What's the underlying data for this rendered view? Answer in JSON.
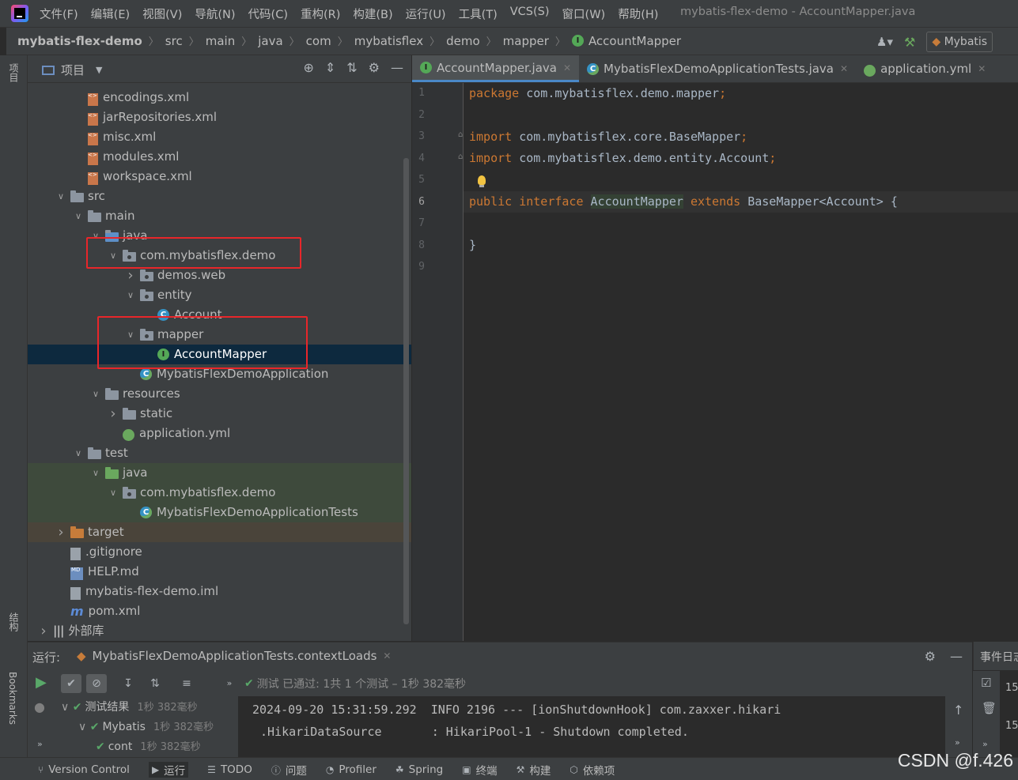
{
  "menubar": {
    "items": [
      "文件(F)",
      "编辑(E)",
      "视图(V)",
      "导航(N)",
      "代码(C)",
      "重构(R)",
      "构建(B)",
      "运行(U)",
      "工具(T)",
      "VCS(S)",
      "窗口(W)",
      "帮助(H)"
    ],
    "window_title": "mybatis-flex-demo - AccountMapper.java"
  },
  "navbar": {
    "breadcrumbs": [
      "mybatis-flex-demo",
      "src",
      "main",
      "java",
      "com",
      "mybatisflex",
      "demo",
      "mapper",
      "AccountMapper"
    ],
    "run_config": "Mybatis"
  },
  "left_strip": {
    "project_label": "项目",
    "structure_label": "结构",
    "bookmarks_label": "Bookmarks"
  },
  "project_panel": {
    "title": "项目",
    "tree": [
      {
        "label": "encodings.xml",
        "icon": "xml-file-icon",
        "depth": 3
      },
      {
        "label": "jarRepositories.xml",
        "icon": "xml-file-icon",
        "depth": 3
      },
      {
        "label": "misc.xml",
        "icon": "xml-file-icon",
        "depth": 3
      },
      {
        "label": "modules.xml",
        "icon": "xml-file-icon",
        "depth": 3
      },
      {
        "label": "workspace.xml",
        "icon": "xml-file-icon",
        "depth": 3
      },
      {
        "label": "src",
        "icon": "folder-icon",
        "depth": 2,
        "arrow": "open"
      },
      {
        "label": "main",
        "icon": "folder-icon",
        "depth": 3,
        "arrow": "open"
      },
      {
        "label": "java",
        "icon": "source-folder-icon",
        "depth": 4,
        "arrow": "open"
      },
      {
        "label": "com.mybatisflex.demo",
        "icon": "package-icon",
        "depth": 5,
        "arrow": "open"
      },
      {
        "label": "demos.web",
        "icon": "package-icon",
        "depth": 6,
        "arrow": "closed"
      },
      {
        "label": "entity",
        "icon": "package-icon",
        "depth": 6,
        "arrow": "open"
      },
      {
        "label": "Account",
        "icon": "class-icon",
        "depth": 7
      },
      {
        "label": "mapper",
        "icon": "package-icon",
        "depth": 6,
        "arrow": "open"
      },
      {
        "label": "AccountMapper",
        "icon": "interface-icon",
        "depth": 7,
        "selected": true
      },
      {
        "label": "MybatisFlexDemoApplication",
        "icon": "spring-class-icon",
        "depth": 6
      },
      {
        "label": "resources",
        "icon": "resources-folder-icon",
        "depth": 4,
        "arrow": "open"
      },
      {
        "label": "static",
        "icon": "folder-icon",
        "depth": 5,
        "arrow": "closed"
      },
      {
        "label": "application.yml",
        "icon": "yml-file-icon",
        "depth": 5
      },
      {
        "label": "test",
        "icon": "folder-icon",
        "depth": 3,
        "arrow": "open"
      },
      {
        "label": "java",
        "icon": "test-folder-icon",
        "depth": 4,
        "arrow": "open",
        "test": true
      },
      {
        "label": "com.mybatisflex.demo",
        "icon": "package-icon",
        "depth": 5,
        "arrow": "open",
        "test": true
      },
      {
        "label": "MybatisFlexDemoApplicationTests",
        "icon": "spring-class-icon",
        "depth": 6,
        "test": true
      },
      {
        "label": "target",
        "icon": "excluded-folder-icon",
        "depth": 2,
        "arrow": "closed",
        "target": true
      },
      {
        "label": ".gitignore",
        "icon": "file-icon",
        "depth": 2
      },
      {
        "label": "HELP.md",
        "icon": "markdown-file-icon",
        "depth": 2
      },
      {
        "label": "mybatis-flex-demo.iml",
        "icon": "iml-file-icon",
        "depth": 2
      },
      {
        "label": "pom.xml",
        "icon": "maven-icon",
        "depth": 2
      },
      {
        "label": "外部库",
        "icon": "library-icon",
        "depth": 1,
        "arrow": "closed"
      }
    ]
  },
  "editor": {
    "tabs": [
      {
        "label": "AccountMapper.java",
        "icon": "interface-icon",
        "active": true
      },
      {
        "label": "MybatisFlexDemoApplicationTests.java",
        "icon": "spring-class-icon"
      },
      {
        "label": "application.yml",
        "icon": "yml-file-icon"
      }
    ],
    "line_numbers": [
      "1",
      "2",
      "3",
      "4",
      "5",
      "6",
      "7",
      "8",
      "9"
    ],
    "current_line": "6",
    "code": {
      "l1_kw": "package",
      "l1_rest": " com.mybatisflex.demo.mapper",
      "l3_kw": "import",
      "l3_rest": " com.mybatisflex.core.BaseMapper",
      "l4_kw": "import",
      "l4_rest": " com.mybatisflex.demo.entity.Account",
      "l6_kw1": "public",
      "l6_kw2": "interface",
      "l6_name": "AccountMapper",
      "l6_kw3": "extends",
      "l6_rest": " BaseMapper<Account> {",
      "l8": "}",
      "semicolon": ";"
    }
  },
  "run_panel": {
    "label": "运行:",
    "tab": "MybatisFlexDemoApplicationTests.contextLoads",
    "status": "测试 已通过: 1共 1 个测试 – 1秒 382毫秒",
    "test_tree": [
      {
        "label": "测试结果",
        "time": "1秒 382毫秒"
      },
      {
        "label": "Mybatis",
        "time": "1秒 382毫秒"
      },
      {
        "label": "cont",
        "time": "1秒 382毫秒"
      }
    ],
    "console": [
      "2024-09-20 15:31:59.292  INFO 2196 --- [ionShutdownHook] com.zaxxer.hikari",
      ".HikariDataSource       : HikariPool-1 - Shutdown completed."
    ]
  },
  "event_log": {
    "title": "事件日志",
    "entries": [
      "15",
      "15"
    ]
  },
  "statusbar": {
    "items": [
      {
        "label": "Version Control",
        "icon": "branch-icon"
      },
      {
        "label": "运行",
        "icon": "run-icon",
        "active": true
      },
      {
        "label": "TODO",
        "icon": "list-icon"
      },
      {
        "label": "问题",
        "icon": "problems-icon"
      },
      {
        "label": "Profiler",
        "icon": "profiler-icon"
      },
      {
        "label": "Spring",
        "icon": "spring-icon"
      },
      {
        "label": "终端",
        "icon": "terminal-icon"
      },
      {
        "label": "构建",
        "icon": "hammer-icon"
      },
      {
        "label": "依赖项",
        "icon": "dependencies-icon"
      }
    ]
  },
  "watermark": "CSDN @f.426",
  "colors": {
    "highlight_box": "#e8262a",
    "selection": "#0d293e",
    "keyword": "#cc7832"
  }
}
